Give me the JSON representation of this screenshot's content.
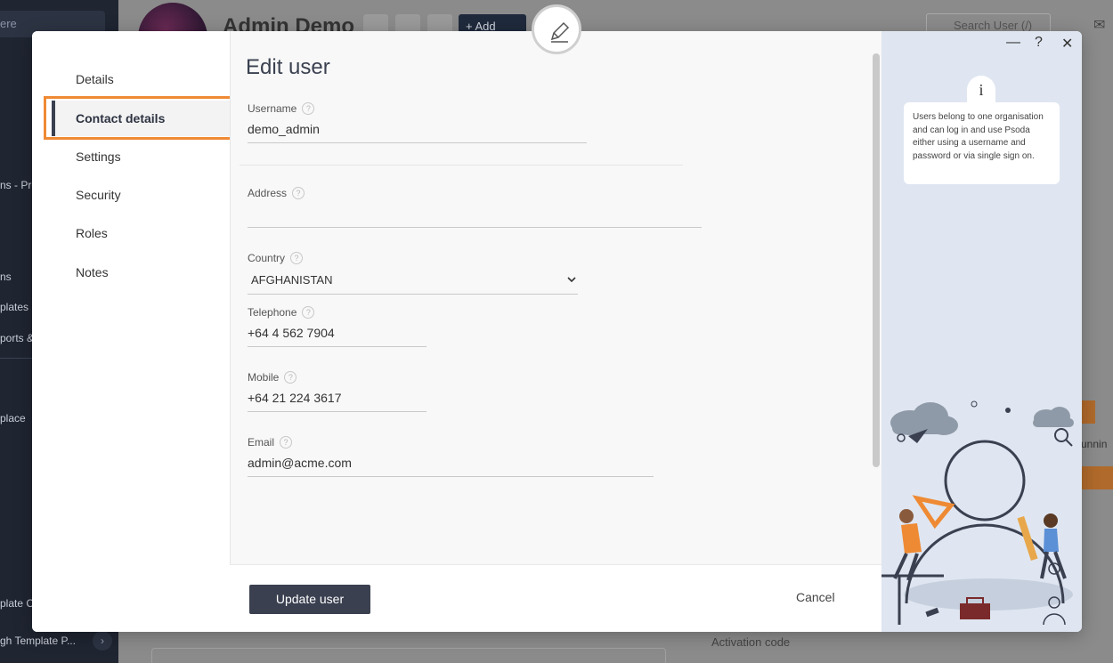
{
  "background": {
    "sidebar": {
      "search_fragment": "ere",
      "items": [
        {
          "label": "ns - Pro"
        },
        {
          "label": "ns"
        },
        {
          "label": "plates"
        },
        {
          "label": "ports &"
        },
        {
          "label": "place"
        },
        {
          "label": "plate C"
        },
        {
          "label": "gh Template P..."
        }
      ],
      "chevron": "›"
    },
    "page_title": "Admin Demo",
    "add_button": "+ Add",
    "search_user": "Search User (/)",
    "runnin_fragment": "unnin",
    "activation_code_label": "Activation code"
  },
  "modal": {
    "title": "Edit user",
    "nav": [
      {
        "label": "Details",
        "active": false
      },
      {
        "label": "Contact details",
        "active": true
      },
      {
        "label": "Settings",
        "active": false
      },
      {
        "label": "Security",
        "active": false
      },
      {
        "label": "Roles",
        "active": false
      },
      {
        "label": "Notes",
        "active": false
      }
    ],
    "fields": {
      "username": {
        "label": "Username",
        "value": "demo_admin"
      },
      "address": {
        "label": "Address",
        "value": ""
      },
      "country": {
        "label": "Country",
        "value": "AFGHANISTAN"
      },
      "telephone": {
        "label": "Telephone",
        "value": "+64 4 562 7904"
      },
      "mobile": {
        "label": "Mobile",
        "value": "+64 21 224 3617"
      },
      "email": {
        "label": "Email",
        "value": "admin@acme.com"
      }
    },
    "help_icon_glyph": "?",
    "footer": {
      "update_label": "Update user",
      "cancel_label": "Cancel"
    }
  },
  "help_panel": {
    "minimize": "—",
    "help": "?",
    "close": "✕",
    "info_glyph": "i",
    "info_text": "Users belong to one organisation and can log in and use Psoda either using a username and password or via single sign on."
  },
  "colors": {
    "highlight": "#ef8a34",
    "primary_button": "#3a4050",
    "panel_bg": "#dfe6f1"
  }
}
